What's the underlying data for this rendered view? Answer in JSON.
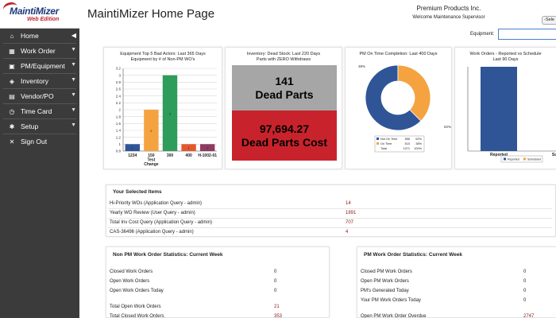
{
  "app": {
    "logo_main": "MaintiMizer",
    "logo_sub": "Web Edition",
    "page_title": "MaintiMizer Home Page",
    "company": "Premium Products Inc.",
    "welcome": "Welcome Maintenance Supervisor",
    "select_button": "-Sele"
  },
  "sidebar": {
    "items": [
      {
        "label": "Home",
        "icon": "home-icon",
        "glyph": "⌂"
      },
      {
        "label": "Work Order",
        "icon": "grid-icon",
        "glyph": "▦"
      },
      {
        "label": "PM/Equipment",
        "icon": "calendar-icon",
        "glyph": "▣"
      },
      {
        "label": "Inventory",
        "icon": "box-icon",
        "glyph": "◈"
      },
      {
        "label": "Vendor/PO",
        "icon": "truck-icon",
        "glyph": "▤"
      },
      {
        "label": "Time Card",
        "icon": "clock-icon",
        "glyph": "◷"
      },
      {
        "label": "Setup",
        "icon": "gear-icon",
        "glyph": "✱"
      },
      {
        "label": "Sign Out",
        "icon": "close-icon",
        "glyph": "✕"
      }
    ]
  },
  "equipment": {
    "label": "Equipment:",
    "value": ""
  },
  "panels": {
    "bad_actors_title": [
      "Equipment Top 5 Bad Actors: Last 365 Days",
      "Equipment by # of Non-PM WO's"
    ],
    "dead_stock_title": [
      "Inventory: Dead Stock: Last 220 Days",
      "Parts with ZERO Withdraws"
    ],
    "dead_parts_count": "141",
    "dead_parts_label": "Dead Parts",
    "dead_parts_cost": "97,694.27",
    "dead_parts_cost_label": "Dead Parts Cost",
    "pm_title": "PM On Time Completion: Last 400 Days",
    "wo_title": [
      "Work Orders - Reported vs Schedule",
      "Last 90 Days"
    ]
  },
  "chart_data": [
    {
      "type": "bar",
      "title": "Equipment Top 5 Bad Actors: Last 365 Days",
      "subtitle": "Equipment by # of Non-PM WO's",
      "categories": [
        "1234",
        "150 Test Change",
        "300",
        "400",
        "H-1002-01"
      ],
      "values": [
        1,
        2,
        3,
        1,
        1
      ],
      "colors": [
        "#2f5597",
        "#f4a340",
        "#2e9c5a",
        "#e4572e",
        "#8e3a63"
      ],
      "ylim": [
        0.8,
        3.2
      ],
      "yticks": [
        "0.8",
        "1",
        "1.2",
        "1.4",
        "1.6",
        "1.8",
        "2",
        "2.2",
        "2.4",
        "2.6",
        "2.8",
        "3",
        "3.2"
      ]
    },
    {
      "type": "pie",
      "title": "PM On Time Completion: Last 400 Days",
      "slices": [
        {
          "name": "Not On Time",
          "value": 856,
          "pct": "62%",
          "color": "#2f5597"
        },
        {
          "name": "On Time",
          "value": 515,
          "pct": "38%",
          "color": "#f4a340"
        }
      ],
      "total": {
        "name": "Total",
        "value": 1371,
        "pct": "100%"
      },
      "labels": [
        "38%",
        "62%"
      ]
    },
    {
      "type": "bar",
      "title": "Work Orders - Reported vs Schedule",
      "subtitle": "Last 90 Days",
      "categories": [
        "Reported",
        "Schedule"
      ],
      "values": [
        100,
        0
      ],
      "colors": [
        "#2f5597",
        "#f4a340"
      ],
      "legend": [
        "Reported",
        "Scheduled"
      ]
    }
  ],
  "selected_items": {
    "title": "Your Selected Items",
    "rows": [
      {
        "label": "Hi-Priority WOs (Application Query - admin)",
        "value": "14"
      },
      {
        "label": "Yearly WO Review (User Query - admin)",
        "value": "1891"
      },
      {
        "label": "Total Inv Cost Query (Application Query - admin)",
        "value": "707"
      },
      {
        "label": "CAS-36496 (Application Query - admin)",
        "value": "4"
      }
    ]
  },
  "non_pm_stats": {
    "title": "Non PM Work Order Statistics: Current Week",
    "rows": [
      {
        "label": "Closed Work Orders",
        "value": "0"
      },
      {
        "label": "Open Work Orders",
        "value": "0"
      },
      {
        "label": "Open Work Orders Today",
        "value": "0"
      },
      {
        "label": "Total Open Work Orders",
        "value": "21"
      },
      {
        "label": "Total Closed Work Orders",
        "value": "353"
      }
    ]
  },
  "pm_stats": {
    "title": "PM Work Order Statistics: Current Week",
    "rows": [
      {
        "label": "Closed PM Work Orders",
        "value": "0"
      },
      {
        "label": "Open PM Work Orders",
        "value": "0"
      },
      {
        "label": "PM's Generated Today",
        "value": "0"
      },
      {
        "label": "Your PM Work Orders Today",
        "value": "0"
      },
      {
        "label": "Open PM Work Order Overdue",
        "value": "2747"
      }
    ]
  }
}
